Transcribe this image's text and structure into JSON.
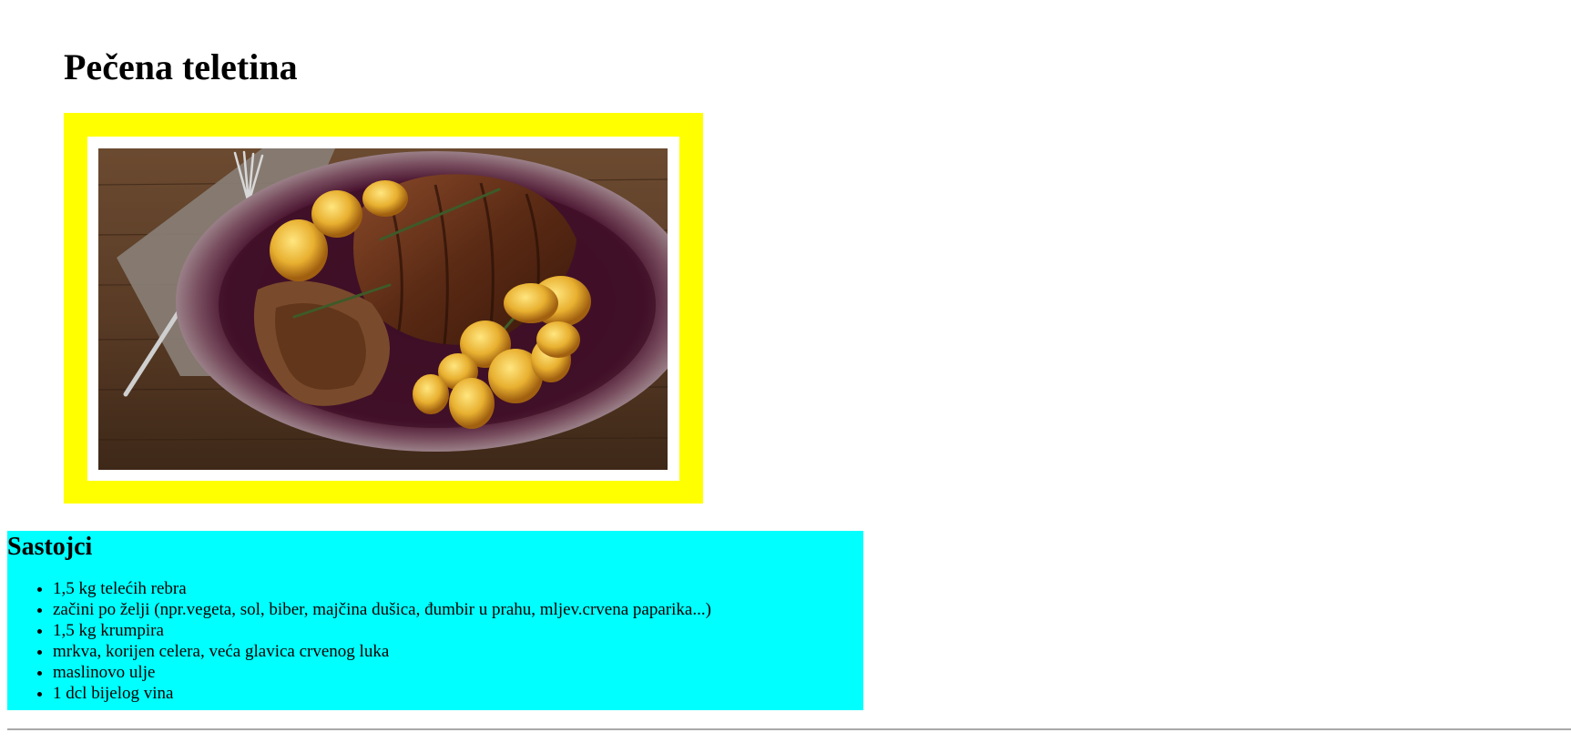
{
  "page": {
    "title": "Pečena teletina"
  },
  "photo": {
    "alt": "Pečena teletina",
    "frame_color": "#ffff00",
    "mat_color": "#ffffff"
  },
  "ingredients": {
    "heading": "Sastojci",
    "background": "#00ffff",
    "items": [
      "1,5 kg telećih rebra",
      "začini po želji (npr.vegeta, sol, biber, majčina dušica, đumbir u prahu, mljev.crvena paparika...)",
      "1,5 kg krumpira",
      "mrkva, korijen celera, veća glavica crvenog luka",
      "maslinovo ulje",
      "1 dcl bijelog vina"
    ]
  }
}
